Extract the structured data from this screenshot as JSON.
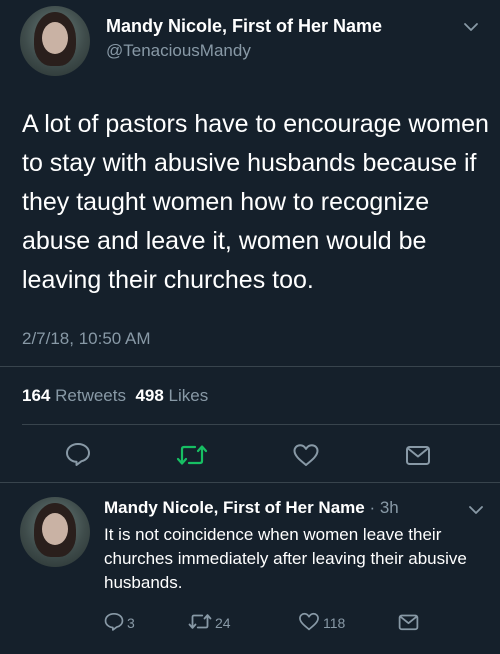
{
  "main_tweet": {
    "display_name": "Mandy Nicole, First of Her Name",
    "handle": "@TenaciousMandy",
    "text": "A lot of pastors have to encourage women to stay with abusive husbands because if they taught women how to recognize abuse and leave it, women would be leaving their churches too.",
    "timestamp": "2/7/18, 10:50 AM",
    "retweets_count": "164",
    "retweets_label": "Retweets",
    "likes_count": "498",
    "likes_label": "Likes"
  },
  "reply_tweet": {
    "display_name": "Mandy Nicole, First of Her Name",
    "time_ago": "3h",
    "text": "It is not coincidence when women leave their churches immediately after leaving their abusive husbands.",
    "reply_count": "3",
    "retweet_count": "24",
    "like_count": "118"
  },
  "colors": {
    "background": "#15202b",
    "secondary_text": "#8899a6",
    "retweet_green": "#17bf63",
    "divider": "#38444d"
  },
  "icons": [
    "reply-icon",
    "retweet-icon",
    "like-icon",
    "share-icon",
    "chevron-down-icon"
  ]
}
